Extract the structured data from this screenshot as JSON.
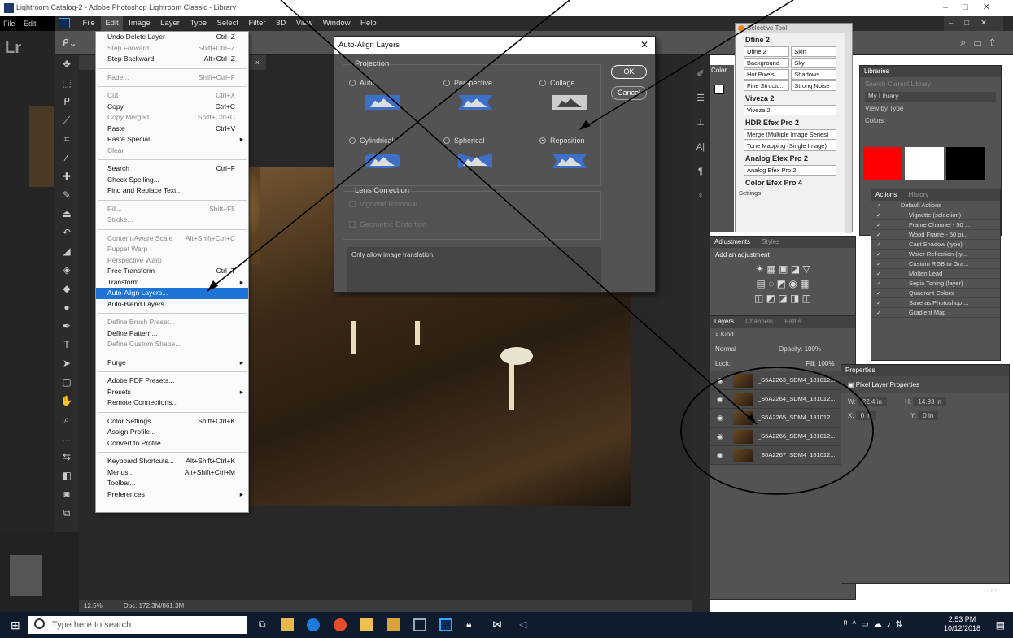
{
  "lightroom": {
    "title": "Lightroom Catalog-2 - Adobe Photoshop Lightroom Classic - Library",
    "menu": [
      "File",
      "Edit"
    ],
    "logo": "Lr"
  },
  "photoshop": {
    "logo": "Ps",
    "menu": [
      "File",
      "Edit",
      "Image",
      "Layer",
      "Type",
      "Select",
      "Filter",
      "3D",
      "View",
      "Window",
      "Help"
    ],
    "status_zoom": "12.5%",
    "status_doc": "Doc: 172.3M/861.3M"
  },
  "edit_menu": {
    "items": [
      {
        "label": "Undo Delete Layer",
        "shortcut": "Ctrl+Z"
      },
      {
        "label": "Step Forward",
        "shortcut": "Shift+Ctrl+Z",
        "disabled": true
      },
      {
        "label": "Step Backward",
        "shortcut": "Alt+Ctrl+Z"
      },
      {
        "sep": true
      },
      {
        "label": "Fade...",
        "shortcut": "Shift+Ctrl+F",
        "disabled": true
      },
      {
        "sep": true
      },
      {
        "label": "Cut",
        "shortcut": "Ctrl+X",
        "disabled": true
      },
      {
        "label": "Copy",
        "shortcut": "Ctrl+C"
      },
      {
        "label": "Copy Merged",
        "shortcut": "Shift+Ctrl+C",
        "disabled": true
      },
      {
        "label": "Paste",
        "shortcut": "Ctrl+V"
      },
      {
        "label": "Paste Special",
        "sub": true
      },
      {
        "label": "Clear",
        "disabled": true
      },
      {
        "sep": true
      },
      {
        "label": "Search",
        "shortcut": "Ctrl+F"
      },
      {
        "label": "Check Spelling..."
      },
      {
        "label": "Find and Replace Text..."
      },
      {
        "sep": true
      },
      {
        "label": "Fill...",
        "shortcut": "Shift+F5",
        "disabled": true
      },
      {
        "label": "Stroke...",
        "disabled": true
      },
      {
        "sep": true
      },
      {
        "label": "Content-Aware Scale",
        "shortcut": "Alt+Shift+Ctrl+C",
        "disabled": true
      },
      {
        "label": "Puppet Warp",
        "disabled": true
      },
      {
        "label": "Perspective Warp",
        "disabled": true
      },
      {
        "label": "Free Transform",
        "shortcut": "Ctrl+T"
      },
      {
        "label": "Transform",
        "sub": true
      },
      {
        "label": "Auto-Align Layers...",
        "selected": true
      },
      {
        "label": "Auto-Blend Layers..."
      },
      {
        "sep": true
      },
      {
        "label": "Define Brush Preset...",
        "disabled": true
      },
      {
        "label": "Define Pattern..."
      },
      {
        "label": "Define Custom Shape...",
        "disabled": true
      },
      {
        "sep": true
      },
      {
        "label": "Purge",
        "sub": true
      },
      {
        "sep": true
      },
      {
        "label": "Adobe PDF Presets..."
      },
      {
        "label": "Presets",
        "sub": true
      },
      {
        "label": "Remote Connections..."
      },
      {
        "sep": true
      },
      {
        "label": "Color Settings...",
        "shortcut": "Shift+Ctrl+K"
      },
      {
        "label": "Assign Profile..."
      },
      {
        "label": "Convert to Profile..."
      },
      {
        "sep": true
      },
      {
        "label": "Keyboard Shortcuts...",
        "shortcut": "Alt+Shift+Ctrl+K"
      },
      {
        "label": "Menus...",
        "shortcut": "Alt+Shift+Ctrl+M"
      },
      {
        "label": "Toolbar..."
      },
      {
        "label": "Preferences",
        "sub": true
      }
    ]
  },
  "dialog": {
    "title": "Auto-Align Layers",
    "projection_label": "Projection",
    "options": [
      "Auto",
      "Perspective",
      "Collage",
      "Cylindrical",
      "Spherical",
      "Reposition"
    ],
    "selected": "Reposition",
    "ok": "OK",
    "cancel": "Cancel",
    "lens_label": "Lens Correction",
    "vignette": "Vignette Removal",
    "geometric": "Geometric Distortion",
    "description": "Only allow image translation."
  },
  "selective_tool": {
    "title": "Selective Tool",
    "dfine": "Dfine 2",
    "dfine_buttons": [
      "Dfine 2",
      "Skin",
      "Background",
      "Sky",
      "Hot Pixels",
      "Shadows",
      "Fine Structu...",
      "Strong Noise"
    ],
    "viveza": "Viveza 2",
    "viveza_button": "Viveza 2",
    "hdr": "HDR Efex Pro 2",
    "hdr_buttons": [
      "Merge (Multiple Image Series)",
      "Tone Mapping (Single Image)"
    ],
    "analog": "Analog Efex Pro 2",
    "analog_button": "Analog Efex Pro 2",
    "color": "Color Efex Pro 4",
    "settings": "Settings"
  },
  "panels": {
    "color_tab": "Color",
    "libraries_tab": "Libraries",
    "lib_search": "Search Current Library",
    "lib_name": "My Library",
    "lib_view": "View by Type",
    "lib_colors": "Colors",
    "swatches": [
      "#ff0000",
      "#ffffff",
      "#000000"
    ],
    "adjust_tabs": [
      "Adjustments",
      "Styles"
    ],
    "adjust_add": "Add an adjustment",
    "layers_tabs": [
      "Layers",
      "Channels",
      "Paths"
    ],
    "layers_kind": "Kind",
    "layers_blend": "Normal",
    "layers_opacity": "Opacity: 100%",
    "layers_lock": "Lock:",
    "layers_fill": "Fill: 100%",
    "layers": [
      "_S6A2263_SDM4_181012...",
      "_S6A2264_SDM4_181012...",
      "_S6A2265_SDM4_181012...",
      "_S6A2266_SDM4_181012...",
      "_S6A2267_SDM4_181012..."
    ],
    "actions_tabs": [
      "Actions",
      "History"
    ],
    "actions": [
      "Default Actions",
      "Vignette (selection)",
      "Frame Channel - 50 ...",
      "Wood Frame - 50 pi...",
      "Cast Shadow (type)",
      "Water Reflection (ty...",
      "Custom RGB to Gra...",
      "Molten Lead",
      "Sepia Toning (layer)",
      "Quadrant Colors",
      "Save as Photoshop ...",
      "Gradient Map"
    ],
    "props_tab": "Properties",
    "props_title": "Pixel Layer Properties",
    "w": "W:",
    "w_val": "22.4 in",
    "h": "H:",
    "h_val": "14.93 in",
    "x": "X:",
    "x_val": "0 in",
    "y": "Y:",
    "y_val": "0 in",
    "kb": "-- KB"
  },
  "taskbar": {
    "search": "Type here to search",
    "time": "2:53 PM",
    "date": "10/12/2018"
  }
}
